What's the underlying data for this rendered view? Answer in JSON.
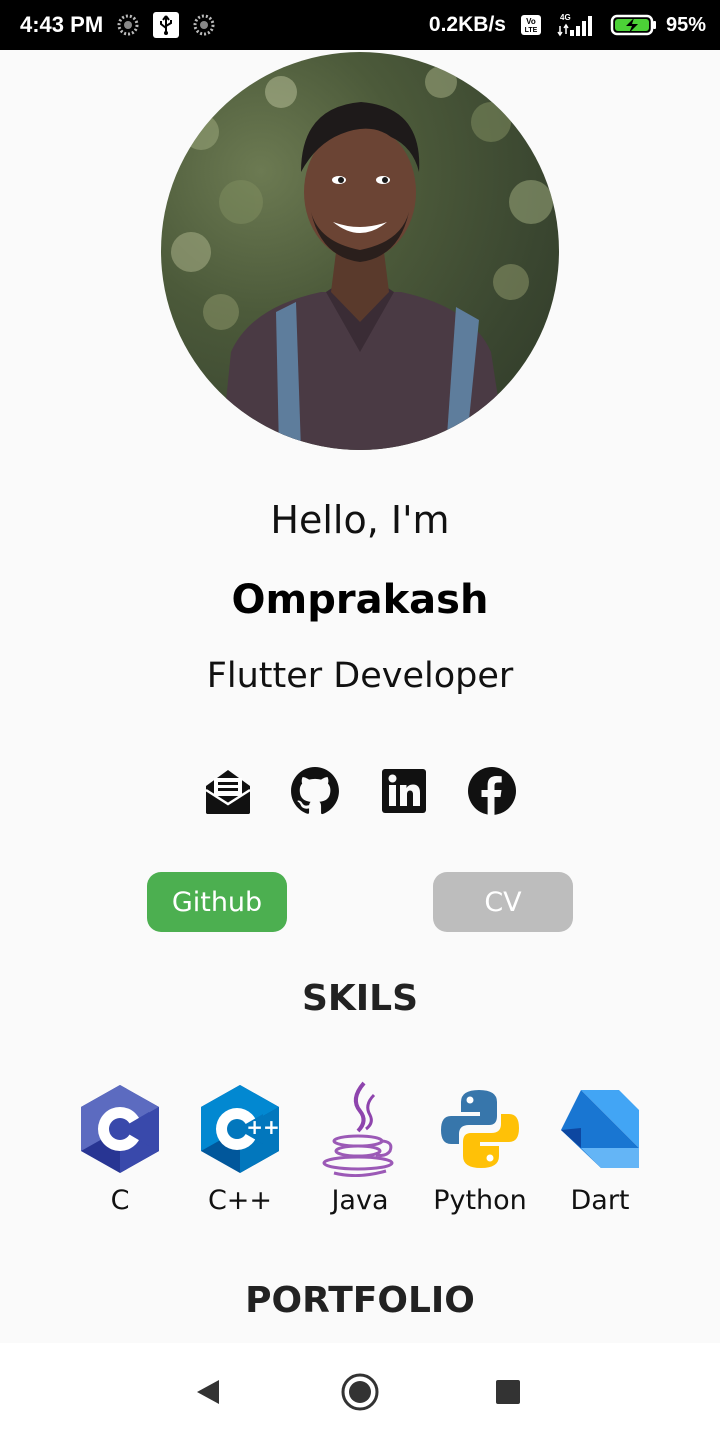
{
  "status_bar": {
    "time": "4:43 PM",
    "network_speed": "0.2KB/s",
    "network_type": "4G",
    "volte_label": "Vo LTE",
    "battery_percent": "95%",
    "icons": [
      "dotted-circle-icon",
      "usb-icon",
      "dotted-circle-icon",
      "volte-icon",
      "signal-icon",
      "battery-charging-icon"
    ]
  },
  "profile": {
    "photo_icon": "profile-photo",
    "greeting": "Hello, I'm",
    "name": "Omprakash",
    "role": "Flutter Developer"
  },
  "social_links": [
    {
      "name": "email",
      "icon": "mail-icon"
    },
    {
      "name": "github",
      "icon": "github-icon"
    },
    {
      "name": "linkedin",
      "icon": "linkedin-icon"
    },
    {
      "name": "facebook",
      "icon": "facebook-icon"
    }
  ],
  "buttons": {
    "github_label": "Github",
    "cv_label": "CV"
  },
  "skills": {
    "title": "SKILS",
    "items": [
      {
        "label": "C",
        "icon": "c-language-icon"
      },
      {
        "label": "C++",
        "icon": "cpp-icon"
      },
      {
        "label": "Java",
        "icon": "java-icon"
      },
      {
        "label": "Python",
        "icon": "python-icon"
      },
      {
        "label": "Dart",
        "icon": "dart-icon"
      }
    ]
  },
  "portfolio": {
    "title": "PORTFOLIO"
  },
  "nav_bar": {
    "icons": [
      "back-icon",
      "home-icon",
      "recents-icon"
    ]
  },
  "colors": {
    "background": "#fafafa",
    "github_button": "#4caf50",
    "cv_button": "#bdbdbd",
    "status_bar": "#000000"
  }
}
